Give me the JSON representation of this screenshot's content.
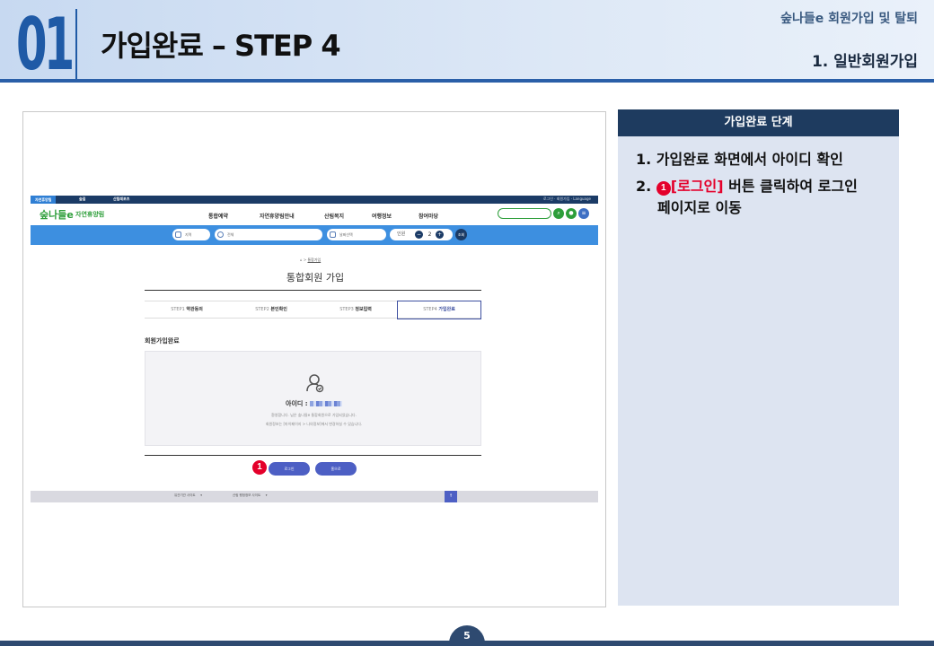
{
  "header": {
    "number": "01",
    "title": "가입완료 – STEP 4",
    "category": "숲나들e 회원가입 및 탈퇴",
    "subtitle": "1. 일반회원가입"
  },
  "screenshot": {
    "topbar": {
      "tabs": [
        "자연휴양림",
        "숲길",
        "산림레포츠"
      ],
      "right_links": "로그인 · 회원가입 · Language"
    },
    "nav": {
      "logo": "숲나들e",
      "logo_sub": "자연휴양림",
      "menu": [
        "통합예약",
        "자연휴양림안내",
        "산림복지",
        "여행정보",
        "참여마당"
      ]
    },
    "searchbar": {
      "fields": [
        "지역",
        "전체",
        "날짜선택"
      ],
      "guest_label": "인원",
      "guest_count": "2",
      "go_label": "조회"
    },
    "breadcrumb": "통합가입",
    "page_heading": "통합회원 가입",
    "steps": [
      {
        "num": "STEP1",
        "label": "약관동의"
      },
      {
        "num": "STEP2",
        "label": "본인확인"
      },
      {
        "num": "STEP3",
        "label": "정보입력"
      },
      {
        "num": "STEP4",
        "label": "가입완료"
      }
    ],
    "section_title": "회원가입완료",
    "id_label": "아이디 :",
    "message_1": "환영합니다.          님은 숲나들e 통합회원으로 가입되었습니다.",
    "message_2": "회원정보는 [마이페이지 > 나의정보]에서 변경하실 수 있습니다.",
    "login_button": "로그인",
    "home_button": "홈으로",
    "marker": "1",
    "footer_selects": [
      "유관기관 사이트",
      "산림 행정정보 사이트"
    ],
    "footer_btn": "↑"
  },
  "panel": {
    "title": "가입완료 단계",
    "step1": "1. 가입완료 화면에서 아이디 확인",
    "step2_num": "2.",
    "step2_marker": "1",
    "step2_highlight": "[로그인]",
    "step2_text": " 버튼 클릭하여 로그인",
    "step2_line2": "페이지로 이동"
  },
  "page_number": "5",
  "colors": {
    "brand_blue": "#1f5aa6",
    "panel_dark": "#1e3b5f",
    "highlight_red": "#e4002b",
    "button_blue": "#4d5fc4"
  }
}
